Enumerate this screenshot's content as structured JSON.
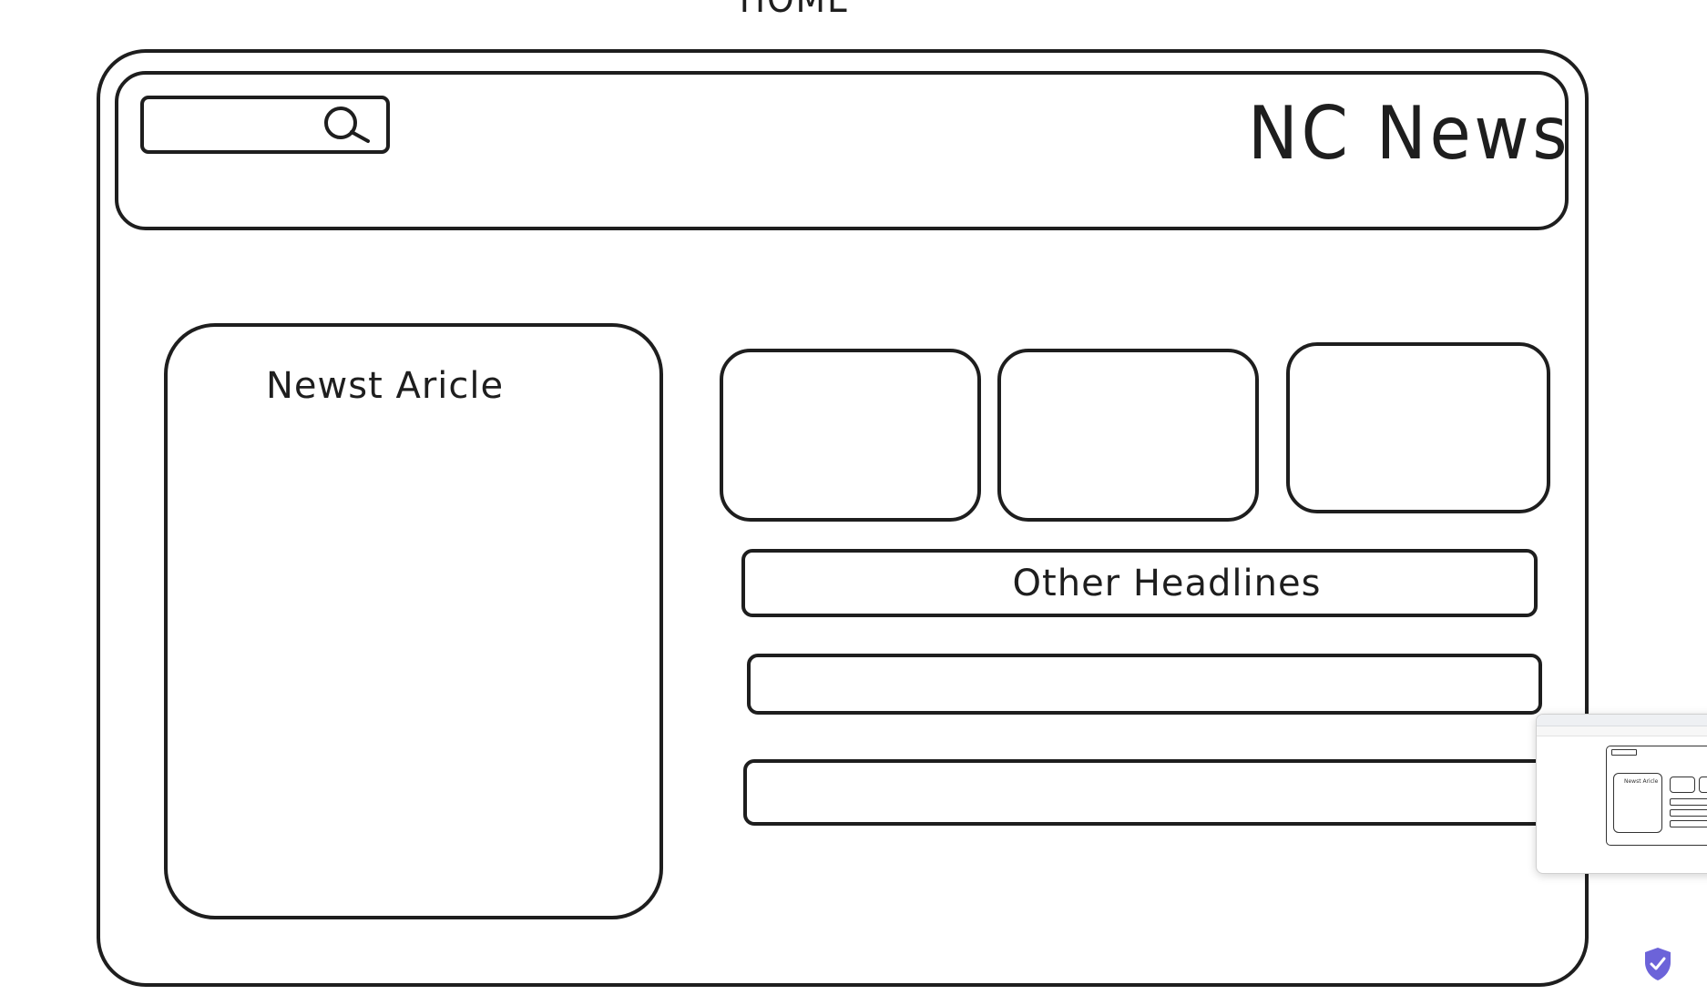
{
  "canvas": {
    "frame_title": "HOME"
  },
  "header": {
    "search": {
      "value": "",
      "placeholder": ""
    },
    "brand": "NC News"
  },
  "main": {
    "newest_article_label": "Newst Aricle",
    "other_headlines_label": "Other Headlines",
    "tiles_count": 3,
    "headline_rows_count": 2
  },
  "overlay": {
    "thumbnail_caption": "Newst Aricle",
    "accent_color": "#6c63d9"
  }
}
